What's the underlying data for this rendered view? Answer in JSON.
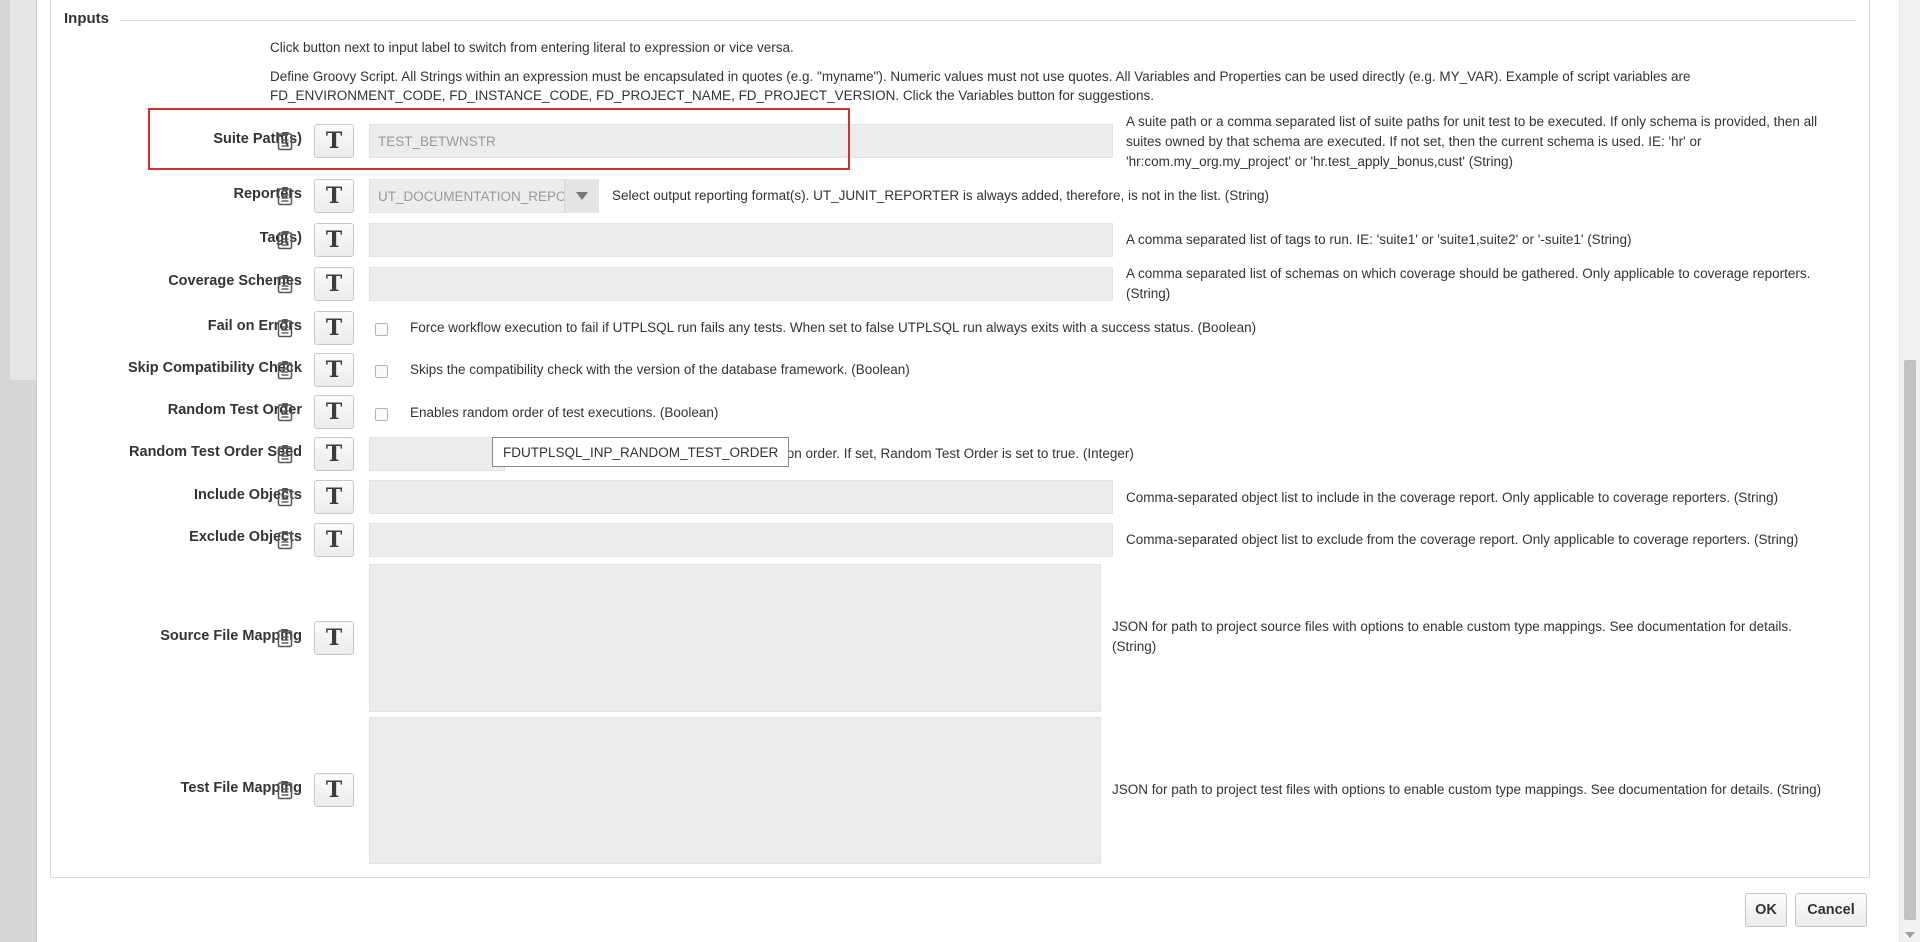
{
  "section": {
    "title": "Inputs",
    "hint_toggle": "Click button next to input label to switch from entering literal to expression or vice versa.",
    "hint_groovy_line1": "Define Groovy Script. All Strings within an expression must be encapsulated in quotes (e.g. \"myname\"). Numeric values must not use quotes. All Variables and Properties can be used directly (e.g. MY_VAR). Example of script variables are",
    "hint_groovy_line2": "FD_ENVIRONMENT_CODE, FD_INSTANCE_CODE, FD_PROJECT_NAME, FD_PROJECT_VERSION. Click the Variables button for suggestions."
  },
  "toggle_button_label": "T",
  "icons": {
    "variables": "clipboard-icon",
    "dropdown": "chevron-down-icon"
  },
  "colors": {
    "highlight": "#d32f2f"
  },
  "inputs": [
    {
      "label": "Suite Path(s)",
      "value": "TEST_BETWNSTR",
      "desc_line1": "A suite path or a comma separated list of suite paths for unit test to be executed. If only schema is provided, then all",
      "desc_line2": "suites owned by that schema are executed. If not set, then the current schema is used. IE: 'hr' or",
      "desc_line3": "'hr:com.my_org.my_project' or 'hr.test_apply_bonus,cust' (String)"
    },
    {
      "label": "Reporters",
      "value": "UT_DOCUMENTATION_REPOF",
      "desc": "Select output reporting format(s). UT_JUNIT_REPORTER is always added, therefore, is not in the list. (String)"
    },
    {
      "label": "Tag(s)",
      "value": "",
      "desc": "A comma separated list of tags to run. IE: 'suite1' or 'suite1,suite2' or '-suite1' (String)"
    },
    {
      "label": "Coverage Schemes",
      "value": "",
      "desc_line1": "A comma separated list of schemas on which coverage should be gathered. Only applicable to coverage reporters.",
      "desc_line2": "(String)"
    },
    {
      "label": "Fail on Errors",
      "desc": "Force workflow execution to fail if UTPLSQL run fails any tests. When set to false UTPLSQL run always exits with a success status. (Boolean)"
    },
    {
      "label": "Skip Compatibility Check",
      "desc": "Skips the compatibility check with the version of the database framework. (Boolean)"
    },
    {
      "label": "Random Test Order",
      "desc": "Enables random order of test executions. (Boolean)"
    },
    {
      "label": "Random Test Order Seed",
      "value": "",
      "desc": "tion order. If set, Random Test Order is set to true. (Integer)",
      "tooltip": "FDUTPLSQL_INP_RANDOM_TEST_ORDER"
    },
    {
      "label": "Include Objects",
      "value": "",
      "desc": "Comma-separated object list to include in the coverage report. Only applicable to coverage reporters. (String)"
    },
    {
      "label": "Exclude Objects",
      "value": "",
      "desc": "Comma-separated object list to exclude from the coverage report. Only applicable to coverage reporters. (String)"
    },
    {
      "label": "Source File Mapping",
      "value": "",
      "desc_line1": "JSON for path to project source files with options to enable custom type mappings. See documentation for details.",
      "desc_line2": "(String)"
    },
    {
      "label": "Test File Mapping",
      "value": "",
      "desc": "JSON for path to project test files with options to enable custom type mappings. See documentation for details. (String)"
    }
  ],
  "footer": {
    "ok": "OK",
    "cancel": "Cancel"
  }
}
